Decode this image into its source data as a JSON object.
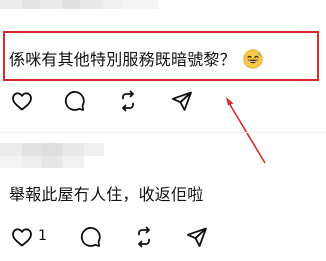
{
  "post1": {
    "text": "係咪有其他特別服務既暗號黎？",
    "emoji": "grinning-sweat-emoji"
  },
  "post2": {
    "text": "舉報此屋冇人住，收返佢啦",
    "like_count": "1"
  },
  "actions": [
    "like-icon",
    "comment-icon",
    "repost-icon",
    "share-icon"
  ],
  "colors": {
    "annotation_red": "#d92b2b",
    "text": "#111111",
    "redacted_gray": "#e2e2e2"
  }
}
